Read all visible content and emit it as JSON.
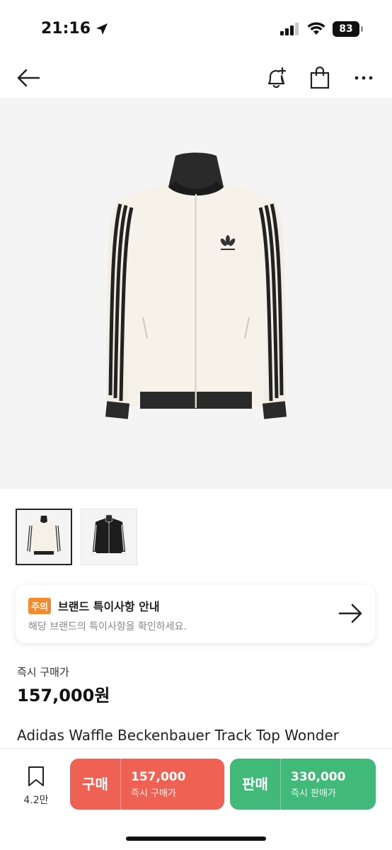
{
  "status_bar": {
    "time": "21:16",
    "battery": "83"
  },
  "thumbnails": [
    {
      "label": "cream-track-top"
    },
    {
      "label": "black-track-top"
    }
  ],
  "notice": {
    "badge": "주의",
    "title": "브랜드 특이사항 안내",
    "subtitle": "해당 브랜드의 특이사항을 확인하세요."
  },
  "price_section": {
    "label": "즉시 구매가",
    "price": "157,000원"
  },
  "product": {
    "name": "Adidas Waffle Beckenbauer Track Top Wonder"
  },
  "bottom_bar": {
    "wish_count": "4.2만",
    "buy": {
      "label": "구매",
      "price": "157,000",
      "sub": "즉시 구매가"
    },
    "sell": {
      "label": "판매",
      "price": "330,000",
      "sub": "즉시 판매가"
    }
  },
  "colors": {
    "buy": "#ef6253",
    "sell": "#41b979",
    "notice_badge": "#f28b2c"
  }
}
